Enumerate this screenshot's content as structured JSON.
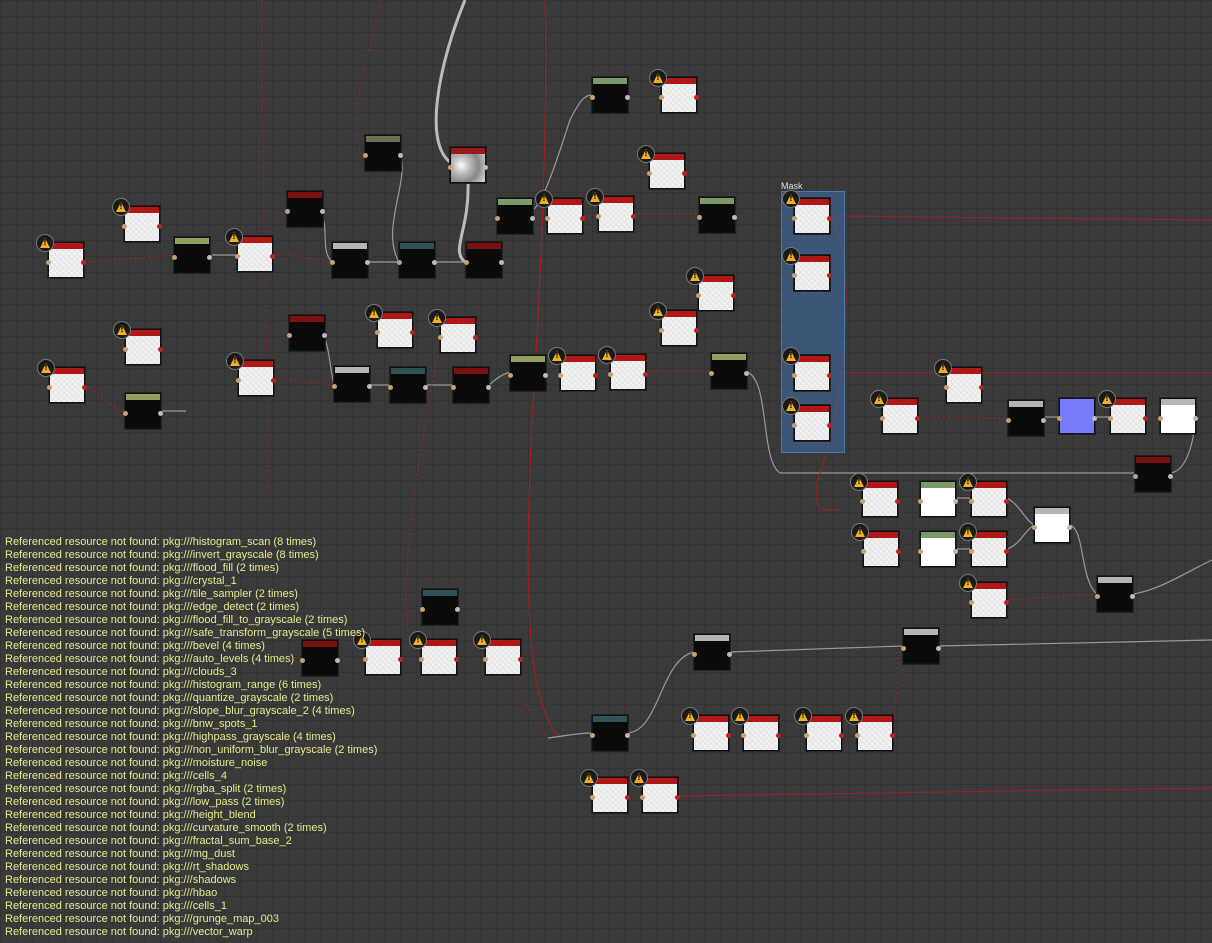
{
  "frame": {
    "title": "Mask"
  },
  "console": {
    "messages": [
      "Referenced resource not found: pkg:///histogram_scan (8 times)",
      "Referenced resource not found: pkg:///invert_grayscale (8 times)",
      "Referenced resource not found: pkg:///flood_fill (2 times)",
      "Referenced resource not found: pkg:///crystal_1",
      "Referenced resource not found: pkg:///tile_sampler (2 times)",
      "Referenced resource not found: pkg:///edge_detect (2 times)",
      "Referenced resource not found: pkg:///flood_fill_to_grayscale (2 times)",
      "Referenced resource not found: pkg:///safe_transform_grayscale (5 times)",
      "Referenced resource not found: pkg:///bevel (4 times)",
      "Referenced resource not found: pkg:///auto_levels (4 times)",
      "Referenced resource not found: pkg:///clouds_3",
      "Referenced resource not found: pkg:///histogram_range (6 times)",
      "Referenced resource not found: pkg:///quantize_grayscale (2 times)",
      "Referenced resource not found: pkg:///slope_blur_grayscale_2 (4 times)",
      "Referenced resource not found: pkg:///bnw_spots_1",
      "Referenced resource not found: pkg:///highpass_grayscale (4 times)",
      "Referenced resource not found: pkg:///non_uniform_blur_grayscale (2 times)",
      "Referenced resource not found: pkg:///moisture_noise",
      "Referenced resource not found: pkg:///cells_4",
      "Referenced resource not found: pkg:///rgba_split (2 times)",
      "Referenced resource not found: pkg:///low_pass (2 times)",
      "Referenced resource not found: pkg:///height_blend",
      "Referenced resource not found: pkg:///curvature_smooth (2 times)",
      "Referenced resource not found: pkg:///fractal_sum_base_2",
      "Referenced resource not found: pkg:///mg_dust",
      "Referenced resource not found: pkg:///rt_shadows",
      "Referenced resource not found: pkg:///shadows",
      "Referenced resource not found: pkg:///hbao",
      "Referenced resource not found: pkg:///cells_1",
      "Referenced resource not found: pkg:///grunge_map_003",
      "Referenced resource not found: pkg:///vector_warp"
    ]
  },
  "colors": {
    "missing_header": "#a01818",
    "green_header": "#8a9a5a",
    "teal_header": "#2d4f52",
    "gray_header": "#b0b0b0",
    "olive_header": "#6a6a52",
    "link_gray": "#9a9a9a",
    "link_red": "#a02020",
    "warning": "#f0b020",
    "console_text": "#e8e890",
    "frame": "#3c6eaa"
  },
  "node_types": {
    "missing": {
      "header": "#b01818",
      "body": "hatch",
      "icon": "warning-icon"
    },
    "green": {
      "header": "#8fa060",
      "body": "#0a0a0a"
    },
    "greenw": {
      "header": "#7a9a6a",
      "body": "#ffffff"
    },
    "teal": {
      "header": "#2e5356",
      "body": "#0a0a0a"
    },
    "gray": {
      "header": "#b5b5b5",
      "body": "#0a0a0a"
    },
    "grayw": {
      "header": "#b5b5b5",
      "body": "#ffffff"
    },
    "dred": {
      "header": "#7a1010",
      "body": "#0a0a0a"
    },
    "olive": {
      "header": "#6f6f58",
      "body": "#0a0a0a"
    },
    "blue": {
      "header": "#7a7aff",
      "body": "#7a7aff"
    },
    "noise": {
      "header": "#9a1a1a",
      "body": "noise"
    },
    "greenblk": {
      "header": "#7a9a6a",
      "body": "#0a0a0a"
    }
  }
}
